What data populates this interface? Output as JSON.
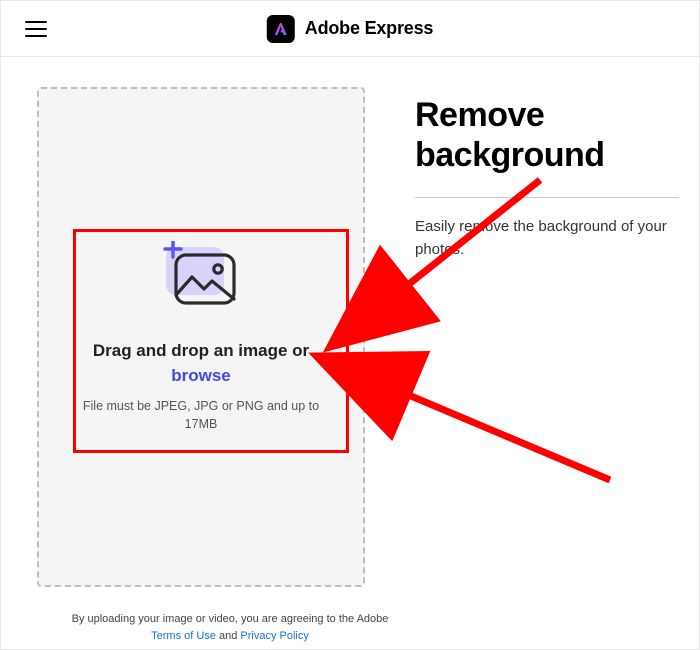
{
  "header": {
    "brand_text": "Adobe Express"
  },
  "dropzone": {
    "drag_text": "Drag and drop an image or",
    "browse_label": "browse",
    "file_requirements": "File must be JPEG, JPG or PNG and up to 17MB"
  },
  "hero": {
    "title_line1": "Remove",
    "title_line2": "background",
    "description": "Easily remove the background of your photos."
  },
  "legal": {
    "prefix": "By uploading your image or video, you are agreeing to the Adobe",
    "terms_label": "Terms of Use",
    "connector": " and ",
    "privacy_label": "Privacy Policy"
  },
  "colors": {
    "link": "#4646ef",
    "annotation": "#ff0000"
  }
}
